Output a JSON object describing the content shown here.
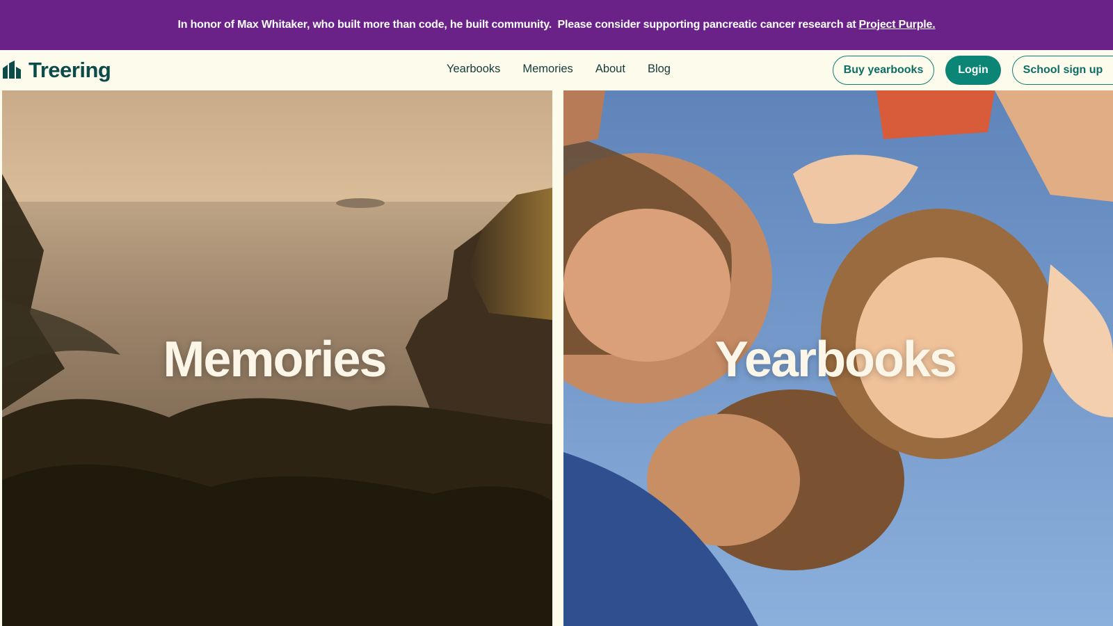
{
  "announcement": {
    "message": "In honor of Max Whitaker, who built more than code, he built community.  Please consider supporting pancreatic cancer research at",
    "link_text": "Project Purple."
  },
  "brand": {
    "name": "Treering",
    "logo_icon": "treering-logo-icon"
  },
  "nav": {
    "links": [
      "Yearbooks",
      "Memories",
      "About",
      "Blog"
    ],
    "buy_label": "Buy yearbooks",
    "login_label": "Login",
    "school_label": "School sign up"
  },
  "panels": {
    "left_title": "Memories",
    "right_title": "Yearbooks"
  },
  "colors": {
    "announcement_bg": "#6a2188",
    "page_bg": "#fdfbec",
    "brand_teal": "#0b4b4a",
    "accent_teal": "#0a8576"
  }
}
